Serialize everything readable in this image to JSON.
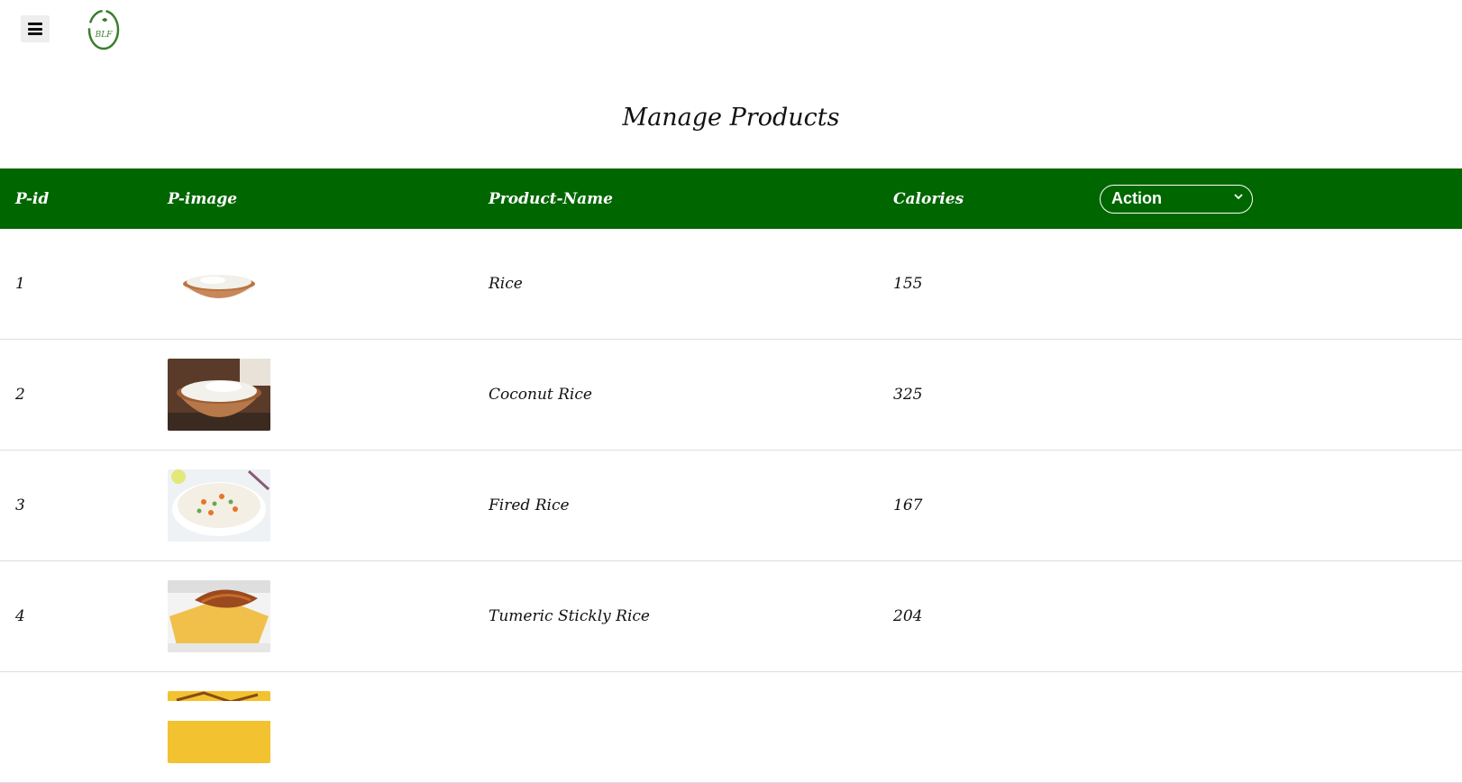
{
  "header": {
    "menu_icon": "hamburger-icon",
    "logo_text": "BLF"
  },
  "page": {
    "title": "Manage Products"
  },
  "table": {
    "columns": [
      "P-id",
      "P-image",
      "Product-Name",
      "Calories"
    ],
    "action_select": {
      "selected": "Action"
    },
    "rows": [
      {
        "id": "1",
        "image": "rice-bowl-image",
        "name": "Rice",
        "calories": "155"
      },
      {
        "id": "2",
        "image": "coconut-rice-image",
        "name": "Coconut Rice",
        "calories": "325"
      },
      {
        "id": "3",
        "image": "fried-rice-image",
        "name": "Fired Rice",
        "calories": "167"
      },
      {
        "id": "4",
        "image": "tumeric-sticky-rice-image",
        "name": "Tumeric Stickly Rice",
        "calories": "204"
      }
    ]
  },
  "colors": {
    "header_green": "#006600",
    "header_text": "#ffffff",
    "row_border": "#dddddd"
  }
}
